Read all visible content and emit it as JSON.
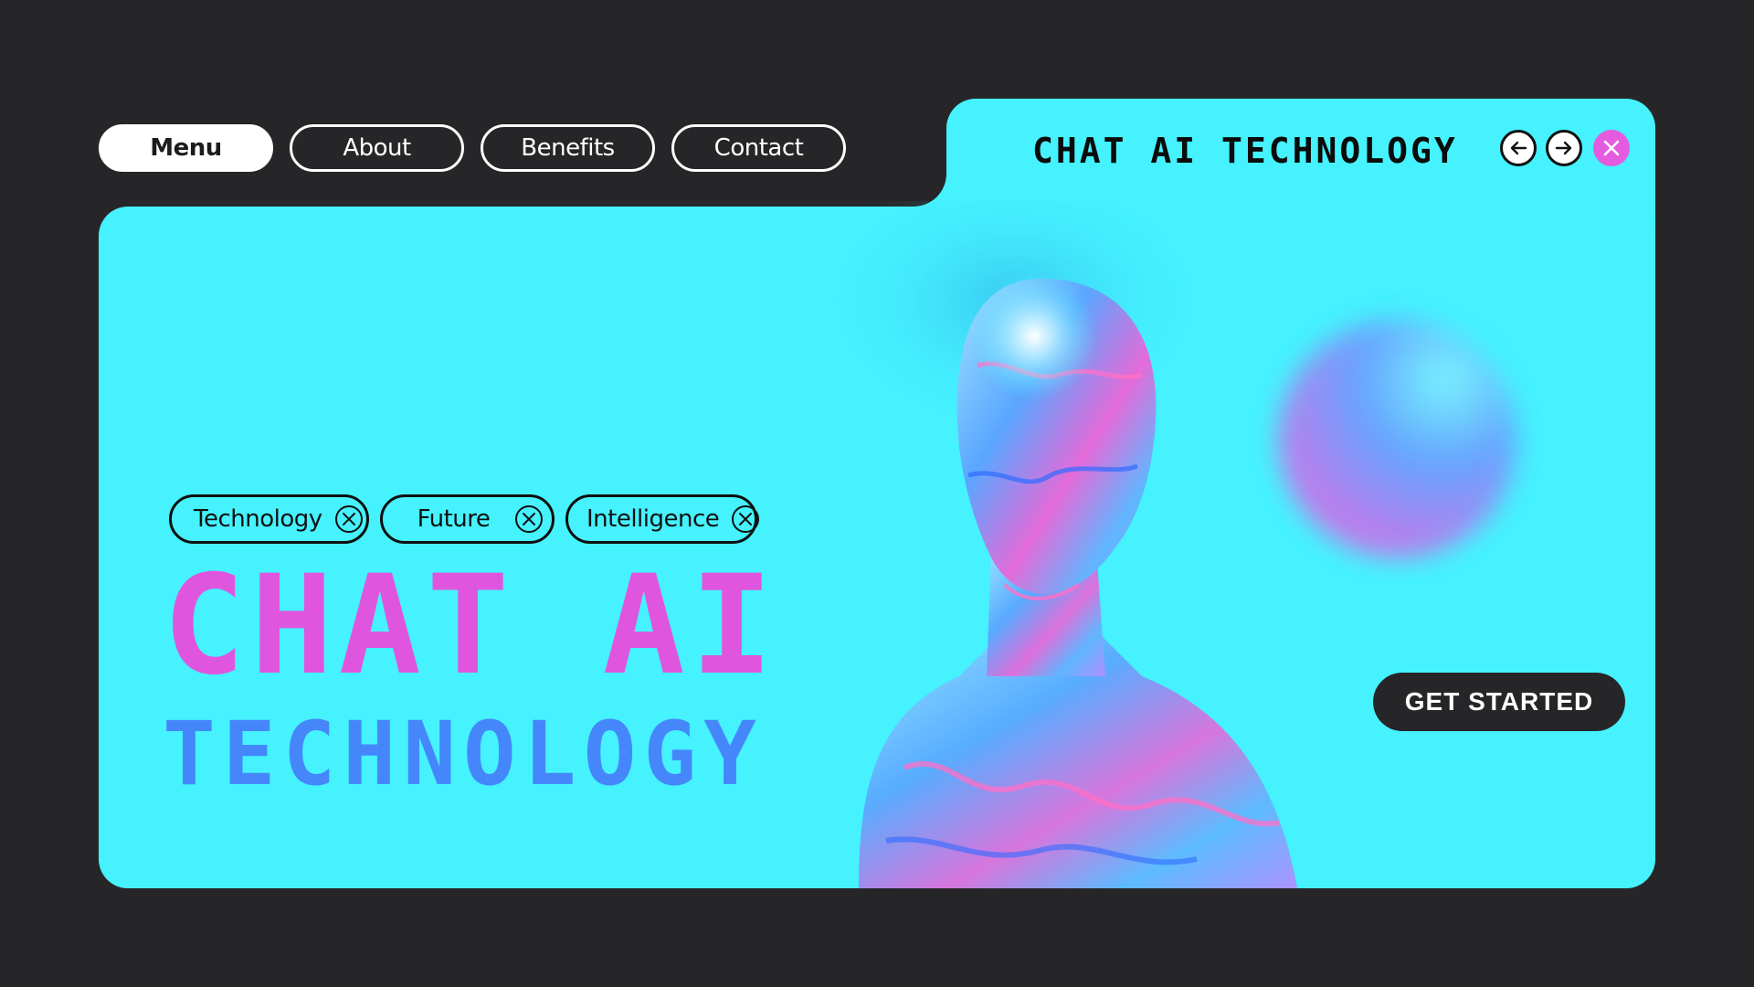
{
  "nav": {
    "items": [
      {
        "label": "Menu",
        "active": true
      },
      {
        "label": "About",
        "active": false
      },
      {
        "label": "Benefits",
        "active": false
      },
      {
        "label": "Contact",
        "active": false
      }
    ]
  },
  "header": {
    "title": "CHAT AI TECHNOLOGY",
    "controls": [
      {
        "icon": "arrow-left-icon"
      },
      {
        "icon": "arrow-right-icon"
      },
      {
        "icon": "close-icon"
      }
    ]
  },
  "tags": [
    {
      "label": "Technology",
      "icon": "close-circle-icon"
    },
    {
      "label": "Future",
      "icon": "close-circle-icon"
    },
    {
      "label": "Intelligence",
      "icon": "close-circle-icon"
    }
  ],
  "hero": {
    "line1": "CHAT AI",
    "line2": "TECHNOLOGY",
    "cta_label": "GET STARTED"
  },
  "colors": {
    "background": "#262628",
    "panel": "#45f2fe",
    "pink": "#e055de",
    "blue": "#4587fb",
    "dark": "#262628"
  }
}
